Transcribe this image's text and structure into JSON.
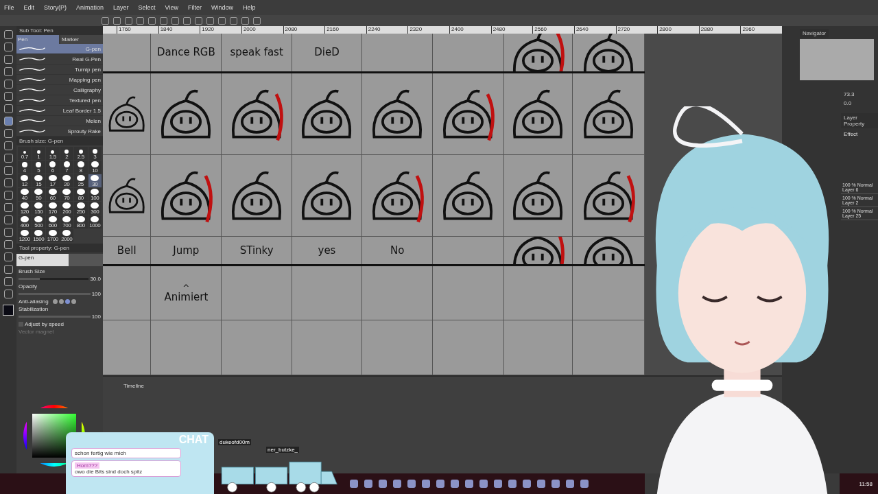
{
  "menu": [
    "File",
    "Edit",
    "Story(P)",
    "Animation",
    "Layer",
    "Select",
    "View",
    "Filter",
    "Window",
    "Help"
  ],
  "sub_tool": {
    "title": "Sub Tool: Pen",
    "tabs": [
      {
        "label": "Pen",
        "selected": true
      },
      {
        "label": "Marker",
        "selected": false
      }
    ],
    "items": [
      {
        "name": "G-pen",
        "selected": true
      },
      {
        "name": "Real G-Pen",
        "selected": false
      },
      {
        "name": "Turnip pen",
        "selected": false
      },
      {
        "name": "Mapping pen",
        "selected": false
      },
      {
        "name": "Calligraphy",
        "selected": false
      },
      {
        "name": "Textured pen",
        "selected": false
      },
      {
        "name": "Leaf Border 1.5",
        "selected": false
      },
      {
        "name": "Melen",
        "selected": false
      },
      {
        "name": "Sprouty Rake",
        "selected": false
      }
    ]
  },
  "brush_size": {
    "title": "Brush size: G-pen",
    "sizes": [
      {
        "label": "0.7",
        "selected": false
      },
      {
        "label": "1",
        "selected": false
      },
      {
        "label": "1.5",
        "selected": false
      },
      {
        "label": "2",
        "selected": false
      },
      {
        "label": "2.5",
        "selected": false
      },
      {
        "label": "3",
        "selected": false
      },
      {
        "label": "4",
        "selected": false
      },
      {
        "label": "5",
        "selected": false
      },
      {
        "label": "6",
        "selected": false
      },
      {
        "label": "7",
        "selected": false
      },
      {
        "label": "8",
        "selected": false
      },
      {
        "label": "10",
        "selected": false
      },
      {
        "label": "12",
        "selected": false
      },
      {
        "label": "15",
        "selected": false
      },
      {
        "label": "17",
        "selected": false
      },
      {
        "label": "20",
        "selected": false
      },
      {
        "label": "25",
        "selected": false
      },
      {
        "label": "30",
        "selected": true
      },
      {
        "label": "40",
        "selected": false
      },
      {
        "label": "50",
        "selected": false
      },
      {
        "label": "60",
        "selected": false
      },
      {
        "label": "70",
        "selected": false
      },
      {
        "label": "80",
        "selected": false
      },
      {
        "label": "100",
        "selected": false
      },
      {
        "label": "120",
        "selected": false
      },
      {
        "label": "150",
        "selected": false
      },
      {
        "label": "170",
        "selected": false
      },
      {
        "label": "200",
        "selected": false
      },
      {
        "label": "250",
        "selected": false
      },
      {
        "label": "300",
        "selected": false
      },
      {
        "label": "400",
        "selected": false
      },
      {
        "label": "500",
        "selected": false
      },
      {
        "label": "600",
        "selected": false
      },
      {
        "label": "700",
        "selected": false
      },
      {
        "label": "800",
        "selected": false
      },
      {
        "label": "1000",
        "selected": false
      },
      {
        "label": "1200",
        "selected": false
      },
      {
        "label": "1500",
        "selected": false
      },
      {
        "label": "1700",
        "selected": false
      },
      {
        "label": "2000",
        "selected": false
      }
    ]
  },
  "tool_property": {
    "title": "Tool property: G-pen",
    "preview_label": "G-pen",
    "sliders": [
      {
        "label": "Brush Size",
        "value": "30.0",
        "level": 0.3
      },
      {
        "label": "Opacity",
        "value": "100",
        "level": 1
      }
    ],
    "anti_aliasing": {
      "label": "Anti-aliasing",
      "options": [
        {
          "selected": false
        },
        {
          "selected": false
        },
        {
          "selected": true
        },
        {
          "selected": false
        }
      ]
    },
    "stabilization": {
      "label": "Stabilization",
      "value": "100",
      "level": 1
    },
    "adjust_by_speed": {
      "label": "Adjust by speed",
      "checked": false
    },
    "vector_magnet": {
      "label": "Vector magnet"
    }
  },
  "ruler": [
    "1760",
    "1840",
    "1920",
    "2000",
    "2080",
    "2160",
    "2240",
    "2320",
    "2400",
    "2480",
    "2560",
    "2640",
    "2720",
    "2800",
    "2880",
    "2960"
  ],
  "canvas": {
    "rows": [
      {
        "cells": [
          {
            "kind": "empty"
          },
          {
            "kind": "label",
            "text": "Dance RGB"
          },
          {
            "kind": "label",
            "text": "speak fast"
          },
          {
            "kind": "label",
            "text": "DieD"
          },
          {
            "kind": "empty"
          },
          {
            "kind": "empty"
          },
          {
            "kind": "sketch"
          },
          {
            "kind": "sketch"
          }
        ]
      },
      {
        "cells": [
          {
            "kind": "sketch"
          },
          {
            "kind": "sketch"
          },
          {
            "kind": "sketch"
          },
          {
            "kind": "sketch"
          },
          {
            "kind": "sketch"
          },
          {
            "kind": "sketch"
          },
          {
            "kind": "sketch"
          },
          {
            "kind": "sketch"
          }
        ]
      },
      {
        "cells": [
          {
            "kind": "sketch"
          },
          {
            "kind": "sketch"
          },
          {
            "kind": "sketch"
          },
          {
            "kind": "sketch"
          },
          {
            "kind": "sketch"
          },
          {
            "kind": "sketch"
          },
          {
            "kind": "sketch"
          },
          {
            "kind": "sketch"
          }
        ]
      },
      {
        "cells": [
          {
            "kind": "label",
            "text": "Bell"
          },
          {
            "kind": "label",
            "text": "Jump"
          },
          {
            "kind": "label",
            "text": "STinky"
          },
          {
            "kind": "label",
            "text": "yes"
          },
          {
            "kind": "label",
            "text": "No"
          },
          {
            "kind": "empty"
          },
          {
            "kind": "sketch"
          },
          {
            "kind": "sketch"
          }
        ]
      },
      {
        "cells": [
          {
            "kind": "empty"
          },
          {
            "kind": "label",
            "text": "Animiert",
            "mark": "^"
          },
          {
            "kind": "empty"
          },
          {
            "kind": "empty"
          },
          {
            "kind": "empty"
          },
          {
            "kind": "empty"
          },
          {
            "kind": "empty"
          },
          {
            "kind": "empty"
          }
        ]
      },
      {
        "cells": [
          {
            "kind": "empty"
          },
          {
            "kind": "empty"
          },
          {
            "kind": "empty"
          },
          {
            "kind": "empty"
          },
          {
            "kind": "empty"
          },
          {
            "kind": "empty"
          },
          {
            "kind": "empty"
          },
          {
            "kind": "empty"
          }
        ]
      }
    ]
  },
  "timeline": {
    "title": "Timeline"
  },
  "navigator": {
    "title": "Navigator",
    "zoom": "73.3",
    "angle": "0.0"
  },
  "layer_property": {
    "title": "Layer Property",
    "effect": "Effect"
  },
  "layers": [
    {
      "mode": "100 % Normal",
      "name": "Layer 6",
      "selected": false
    },
    {
      "mode": "100 % Normal",
      "name": "Layer 2",
      "selected": false
    },
    {
      "mode": "100 % Normal",
      "name": "Layer 25",
      "selected": false
    }
  ],
  "chat": {
    "title": "CHAT",
    "messages": [
      {
        "text": "schon fertig wie mich"
      },
      {
        "user": "Hom???",
        "text": "owo die Bits sind doch spitz"
      }
    ]
  },
  "train": {
    "users": [
      "dukeofd00m",
      "ner_butzke_"
    ]
  },
  "taskbar": {
    "time": "11:58"
  }
}
